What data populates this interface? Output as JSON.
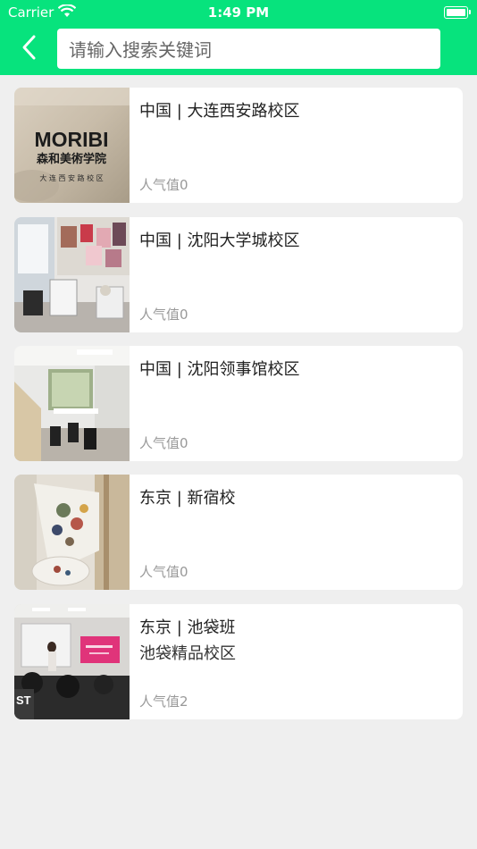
{
  "status_bar": {
    "carrier": "Carrier",
    "time": "1:49 PM"
  },
  "header": {
    "back_icon": "chevron-left-icon",
    "search_placeholder": "请输入搜索关键词"
  },
  "campuses": [
    {
      "title": "中国 | 大连西安路校区",
      "subtitle": "",
      "popularity": "人气值0",
      "image_text": {
        "logo": "MORIBI",
        "name": "森和美術学院",
        "branch": "大 连 西 安 路 校 区"
      }
    },
    {
      "title": "中国 | 沈阳大学城校区",
      "subtitle": "",
      "popularity": "人气值0"
    },
    {
      "title": "中国 | 沈阳领事馆校区",
      "subtitle": "",
      "popularity": "人气值0"
    },
    {
      "title": "东京 | 新宿校",
      "subtitle": "",
      "popularity": "人气值0"
    },
    {
      "title": "东京 | 池袋班",
      "subtitle": "池袋精品校区",
      "popularity": "人气值2"
    }
  ],
  "colors": {
    "header": "#07e37d",
    "background": "#efefef"
  }
}
